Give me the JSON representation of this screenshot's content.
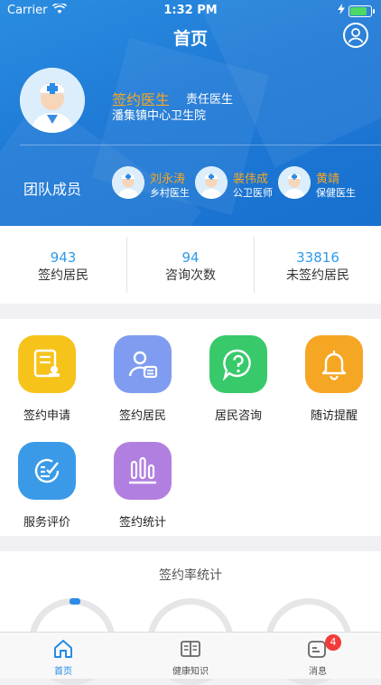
{
  "status_bar": {
    "carrier": "Carrier",
    "time": "1:32 PM",
    "battery_level": 0.9
  },
  "nav": {
    "title": "首页"
  },
  "doctor": {
    "name": "签约医生",
    "role": "责任医生",
    "hospital": "潘集镇中心卫生院"
  },
  "team": {
    "label": "团队成员",
    "members": [
      {
        "name": "刘永涛",
        "role": "乡村医生"
      },
      {
        "name": "裴伟成",
        "role": "公卫医师"
      },
      {
        "name": "黄靖",
        "role": "保健医生"
      }
    ]
  },
  "stats": [
    {
      "value": "943",
      "label": "签约居民"
    },
    {
      "value": "94",
      "label": "咨询次数"
    },
    {
      "value": "33816",
      "label": "未签约居民"
    }
  ],
  "features": [
    {
      "label": "签约申请",
      "icon": "document-stamp-icon",
      "color": "#f6c31b"
    },
    {
      "label": "签约居民",
      "icon": "person-card-icon",
      "color": "#7f9cf0"
    },
    {
      "label": "居民咨询",
      "icon": "question-chat-icon",
      "color": "#38c96b"
    },
    {
      "label": "随访提醒",
      "icon": "bell-icon",
      "color": "#f5a623"
    },
    {
      "label": "服务评价",
      "icon": "checklist-icon",
      "color": "#3a9ae8"
    },
    {
      "label": "签约统计",
      "icon": "bar-stats-icon",
      "color": "#b17fe0"
    }
  ],
  "rate_section": {
    "title": "签约率统计"
  },
  "tabbar": {
    "items": [
      {
        "label": "首页",
        "icon": "home-icon",
        "active": true
      },
      {
        "label": "健康知识",
        "icon": "book-icon",
        "active": false
      },
      {
        "label": "消息",
        "icon": "message-icon",
        "active": false,
        "badge": "4"
      }
    ]
  },
  "colors": {
    "primary": "#1f7ad6",
    "accent_orange": "#f6a623",
    "stat_blue": "#2d9be8"
  }
}
